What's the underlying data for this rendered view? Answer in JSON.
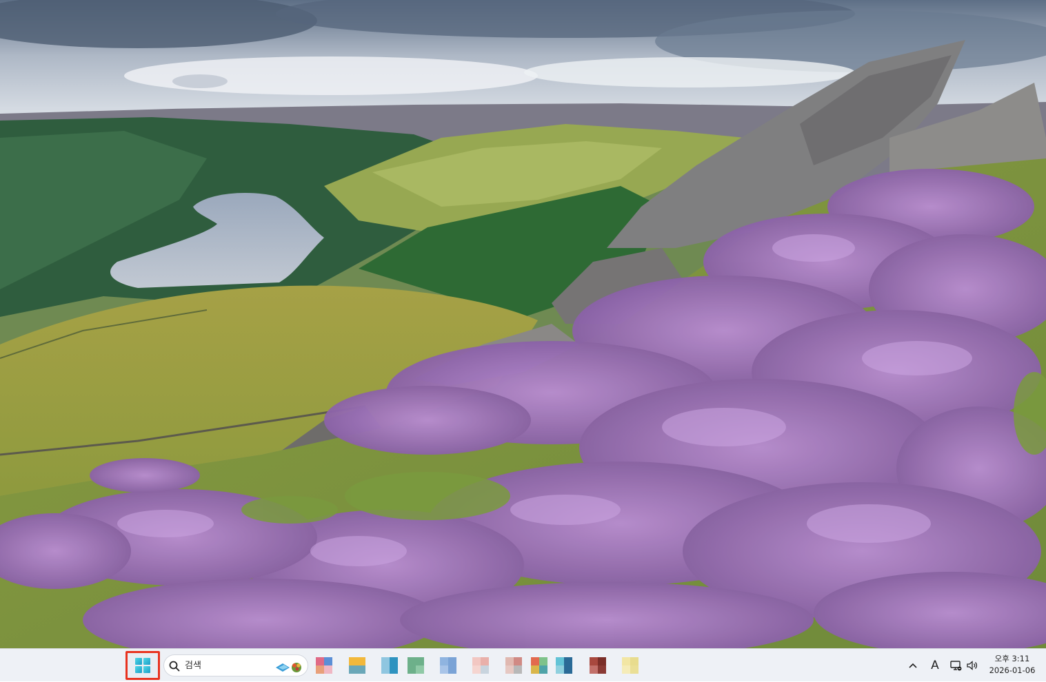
{
  "desktop": {
    "wallpaper": "heather moorland valley with reservoir and gritstone rocks"
  },
  "taskbar": {
    "start_icon": "windows-logo-icon",
    "search": {
      "placeholder": "검색",
      "icon": "search-icon"
    },
    "pinned_apps": [
      {
        "name": "app-1",
        "colors": [
          "#e06a86",
          "#5b8fd6",
          "#e8a07a",
          "#f0b7c4"
        ]
      },
      {
        "name": "app-2",
        "colors": [
          "#f2b83b",
          "#f2b83b",
          "#6aa7b8",
          "#6aa7b8"
        ]
      },
      {
        "name": "app-3",
        "colors": [
          "#8fc6e0",
          "#2e93c0",
          "#8fc6e0",
          "#2e93c0"
        ]
      },
      {
        "name": "app-4",
        "colors": [
          "#6db08a",
          "#6db08a",
          "#6db08a",
          "#8fc9a6"
        ]
      },
      {
        "name": "app-5",
        "colors": [
          "#8fb4e0",
          "#7aa3d6",
          "#a8c4e8",
          "#7aa3d6"
        ]
      },
      {
        "name": "app-6",
        "colors": [
          "#f2c7c2",
          "#e9b0aa",
          "#f5d5d0",
          "#c8d4de"
        ]
      },
      {
        "name": "app-7",
        "colors": [
          "#e0b8b0",
          "#d08a84",
          "#e6c8c2",
          "#b8b8b8"
        ]
      },
      {
        "name": "app-8",
        "colors": [
          "#e26a4e",
          "#7ec28a",
          "#d9b64a",
          "#4ea3a8"
        ]
      },
      {
        "name": "app-9",
        "colors": [
          "#62c3d6",
          "#2a6a96",
          "#8fd0de",
          "#2a6a96"
        ]
      },
      {
        "name": "app-10",
        "colors": [
          "#a8483e",
          "#7a2e28",
          "#c2706a",
          "#8a3a34"
        ]
      },
      {
        "name": "app-11",
        "colors": [
          "#f2e6a4",
          "#e8dc8e",
          "#f5ecb8",
          "#eadf96"
        ]
      }
    ],
    "tray": {
      "chevron": "^",
      "ime": "A",
      "network_icon": "network-icon",
      "volume_icon": "volume-icon"
    },
    "clock": {
      "time": "오후 3:11",
      "date": "2026-01-06"
    }
  }
}
